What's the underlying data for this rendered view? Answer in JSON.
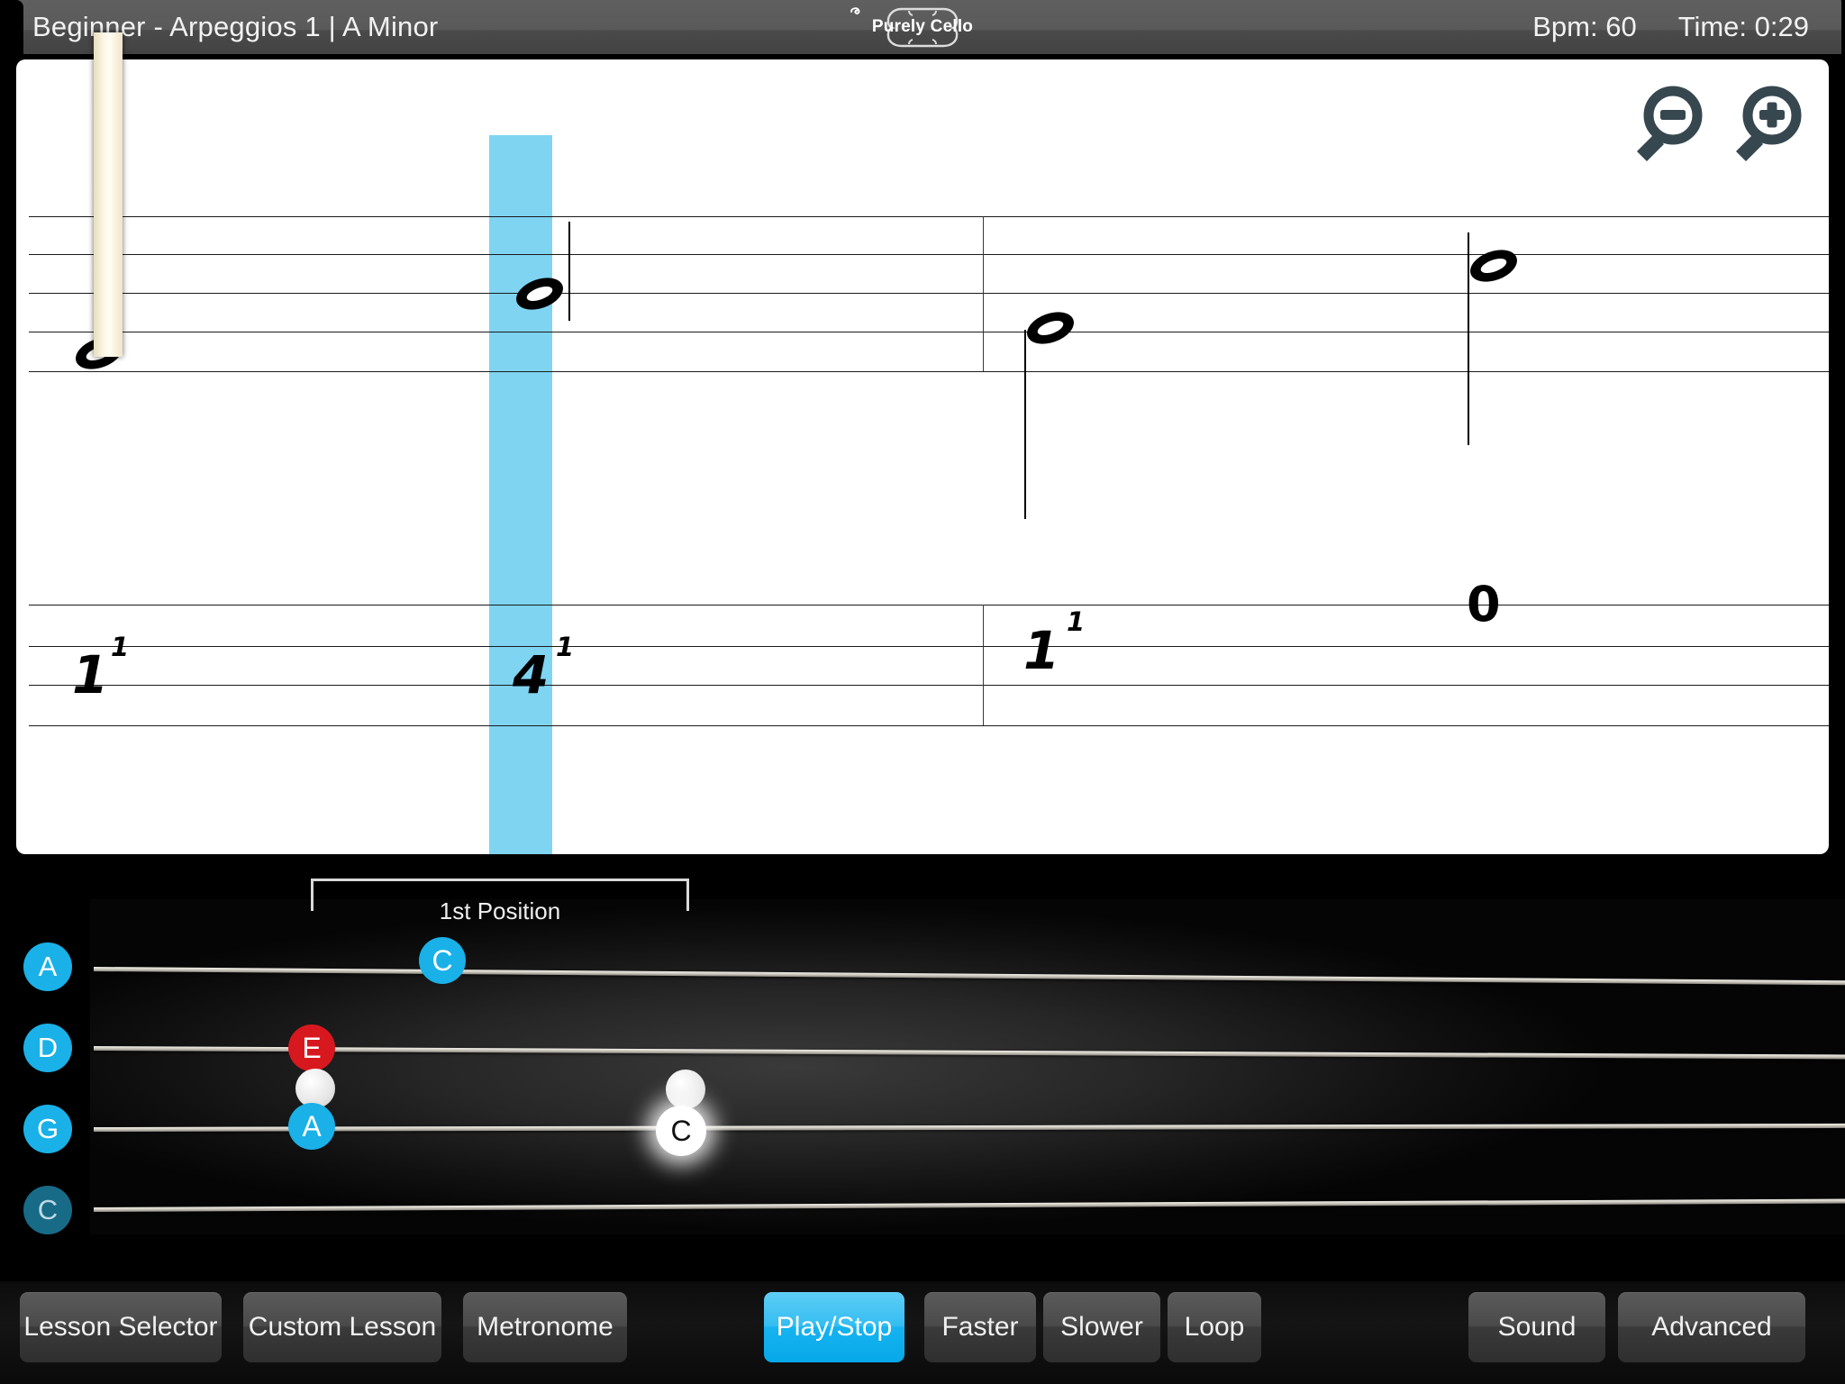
{
  "header": {
    "lesson_title": "Beginner - Arpeggios 1  |  A Minor",
    "logo_text": "Purely Cello",
    "logo_icon": "cello-body-icon",
    "bpm_label": "Bpm: 60",
    "time_label": "Time: 0:29"
  },
  "notation": {
    "zoom_out_icon": "zoom-out-magnifier-icon",
    "zoom_in_icon": "zoom-in-magnifier-icon",
    "prev_arrow": "❮",
    "next_arrow": "❯",
    "highlight_color": "#7FD4F2",
    "notes": [
      {
        "fingering": "1",
        "string_sup": "1",
        "type": "half-note"
      },
      {
        "fingering": "4",
        "string_sup": "1",
        "type": "half-note"
      },
      {
        "fingering": "1",
        "string_sup": "1",
        "type": "half-note"
      },
      {
        "fingering": "0",
        "string_sup": "",
        "type": "half-note"
      }
    ],
    "current_note_index": 1
  },
  "fingerboard": {
    "position_label": "1st Position",
    "strings": [
      {
        "name": "A",
        "active": true
      },
      {
        "name": "D",
        "active": true
      },
      {
        "name": "G",
        "active": true
      },
      {
        "name": "C",
        "active": false
      }
    ],
    "markers": [
      {
        "label": "C",
        "kind": "blue"
      },
      {
        "label": "E",
        "kind": "red"
      },
      {
        "label": "",
        "kind": "gray"
      },
      {
        "label": "A",
        "kind": "blue"
      },
      {
        "label": "",
        "kind": "gray"
      },
      {
        "label": "C",
        "kind": "white-glow"
      }
    ],
    "colors": {
      "blue": "#19B1E8",
      "blue_dim": "#176B87",
      "red": "#D8181F",
      "gray": "#E2E2E2",
      "white": "#FFFFFF"
    }
  },
  "toolbar": {
    "lesson_selector": "Lesson Selector",
    "custom_lesson": "Custom Lesson",
    "metronome": "Metronome",
    "play_stop": "Play/Stop",
    "faster": "Faster",
    "slower": "Slower",
    "loop": "Loop",
    "sound": "Sound",
    "advanced": "Advanced"
  }
}
